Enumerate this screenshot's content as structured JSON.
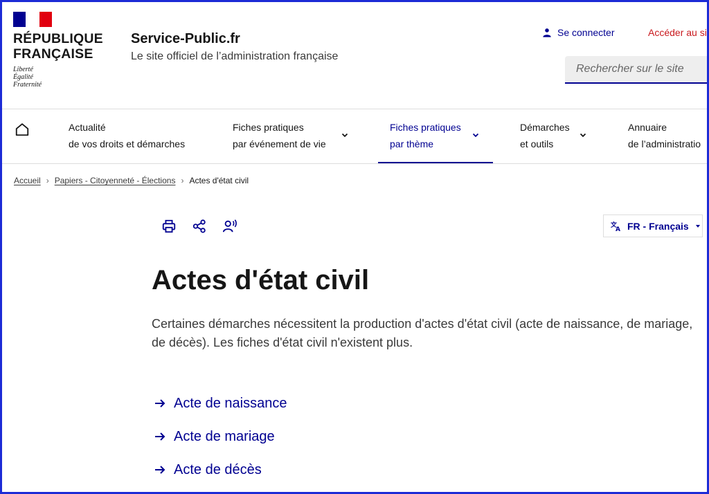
{
  "header": {
    "republic_line1": "RÉPUBLIQUE",
    "republic_line2": "FRANÇAISE",
    "motto": [
      "Liberté",
      "Égalité",
      "Fraternité"
    ],
    "site_title": "Service-Public.fr",
    "site_subtitle": "Le site officiel de l’administration française",
    "login_label": "Se connecter",
    "acceder_label": "Accéder au si",
    "search_placeholder": "Rechercher sur le site"
  },
  "nav": {
    "items": [
      {
        "line1": "Actualité",
        "line2": "de vos droits et démarches"
      },
      {
        "line1": "Fiches pratiques",
        "line2": "par événement de vie"
      },
      {
        "line1": "Fiches pratiques",
        "line2": "par thème"
      },
      {
        "line1": "Démarches",
        "line2": "et outils"
      },
      {
        "line1": "Annuaire",
        "line2": "de l’administratio"
      }
    ]
  },
  "breadcrumb": {
    "items": [
      "Accueil",
      "Papiers - Citoyenneté - Élections"
    ],
    "current": "Actes d'état civil"
  },
  "language": {
    "label": "FR - Français"
  },
  "main": {
    "title": "Actes d'état civil",
    "lead": "Certaines démarches nécessitent la production d'actes d'état civil (acte de naissance, de mariage, de décès). Les fiches d'état civil n'existent plus.",
    "links": [
      "Acte de naissance",
      "Acte de mariage",
      "Acte de décès"
    ]
  },
  "colors": {
    "blue_france": "#000091",
    "red_marianne": "#e1000f",
    "acceder_red": "#c9191e",
    "frame_border": "#1c2bd6"
  }
}
